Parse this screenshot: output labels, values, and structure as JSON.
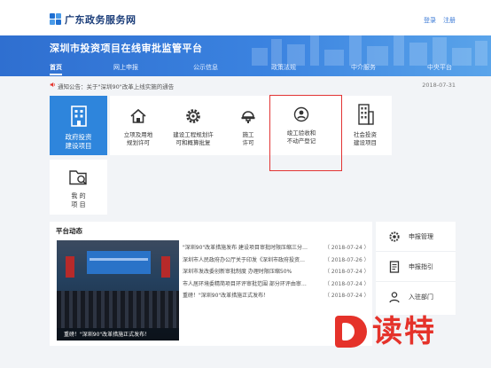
{
  "header": {
    "logo_text": "广东政务服务网",
    "links": [
      "登录",
      "注册"
    ]
  },
  "banner": {
    "title": "深圳市投资项目在线审批监管平台"
  },
  "nav": {
    "items": [
      "首页",
      "网上申报",
      "公示信息",
      "政策法规",
      "中介服务",
      "中央平台"
    ]
  },
  "notice": {
    "label": "通知公告：关于\"深圳90\"改革上线实施的通告",
    "date": "2018-07-31"
  },
  "services": {
    "main": {
      "line1": "政府投资",
      "line2": "建设项目"
    },
    "items": [
      {
        "line1": "立项及用地",
        "line2": "规划许可",
        "icon": "house-icon"
      },
      {
        "line1": "建设工程规划许",
        "line2": "可和概算批复",
        "icon": "gear-icon"
      },
      {
        "line1": "施工",
        "line2": "许可",
        "icon": "helmet-icon"
      },
      {
        "line1": "竣工验收和",
        "line2": "不动产登记",
        "icon": "badge-icon"
      }
    ],
    "social": {
      "line1": "社会投资",
      "line2": "建设项目"
    },
    "my": {
      "line1": "我 的",
      "line2": "项 目"
    }
  },
  "news": {
    "title": "平台动态",
    "photo_caption": "重磅！\"深圳90\"改革措施正式发布！",
    "rows": [
      {
        "text": "\"深圳90\"改革措施发布 建设项目审批时限压缩三分…",
        "date": "（ 2018-07-24 ）"
      },
      {
        "text": "深圳市人民政府办公厅关于印发《深圳市政府投资…",
        "date": "（ 2018-07-26 ）"
      },
      {
        "text": "深圳市发改委创新审批制度 办理时限压缩50%",
        "date": "（ 2018-07-24 ）"
      },
      {
        "text": "市人居环境委精简项目环评审批范围 部分环评由审…",
        "date": "（ 2018-07-24 ）"
      },
      {
        "text": "重磅！\"深圳90\"改革措施正式发布！",
        "date": "（ 2018-07-24 ）"
      }
    ]
  },
  "side_menu": {
    "items": [
      "申报管理",
      "申报指引",
      "入驻部门"
    ]
  },
  "watermark": {
    "text": "读特"
  },
  "colors": {
    "brand_blue": "#2f6fd0",
    "tile_blue": "#2e85dc",
    "highlight_red": "#e23434"
  }
}
